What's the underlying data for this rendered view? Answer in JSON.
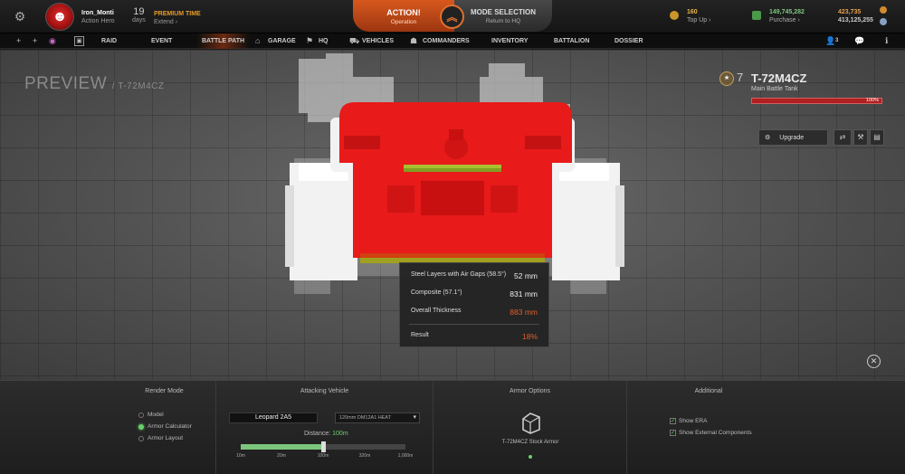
{
  "topbar": {
    "username": "Iron_Monti",
    "rank": "Action Hero",
    "premium_days": "19",
    "premium_days_unit": "days",
    "premium_label": "PREMIUM TIME",
    "premium_action": "Extend ›",
    "action_title": "ACTION!",
    "action_sub": "Operation",
    "mode_title": "MODE SELECTION",
    "mode_sub": "Return to HQ",
    "gold_value": "160",
    "gold_action": "Top Up ›",
    "credits_value": "149,745,282",
    "credits_action": "Purchase ›",
    "xp_value": "423,735",
    "xp2_value": "413,125,255"
  },
  "nav": {
    "items": [
      "RAID",
      "EVENT",
      "BATTLE PATH",
      "GARAGE",
      "HQ",
      "VEHICLES",
      "COMMANDERS",
      "INVENTORY",
      "BATTALION",
      "DOSSIER"
    ],
    "friends_count": "3"
  },
  "preview": {
    "title": "PREVIEW",
    "subtitle": "/ T-72M4CZ"
  },
  "tank": {
    "tier": "7",
    "name": "T-72M4CZ",
    "class": "Main Battle Tank",
    "health": "100%",
    "upgrade_label": "Upgrade"
  },
  "armor": {
    "rows": [
      {
        "label": "Steel Layers with Air Gaps (58.5°)",
        "value": "52 mm"
      },
      {
        "label": "Composite (57.1°)",
        "value": "831 mm"
      },
      {
        "label": "Overall Thickness",
        "value": "883 mm"
      }
    ],
    "result_label": "Result",
    "result_value": "18%"
  },
  "bottom": {
    "render_mode": {
      "title": "Render Mode",
      "options": [
        "Model",
        "Armor Calculator",
        "Armor Layout"
      ],
      "selected": "Armor Calculator"
    },
    "attacking": {
      "title": "Attacking Vehicle",
      "vehicle": "Leopard 2A5",
      "ammo": "120mm DM12A1 HEAT",
      "distance_label": "Distance:",
      "distance_value": "100m",
      "distance_fraction": 0.5,
      "ticks": [
        "10m",
        "20m",
        "100m",
        "320m",
        "1,000m"
      ]
    },
    "armor_options": {
      "title": "Armor Options",
      "caption": "T-72M4CZ Stock Armor"
    },
    "additional": {
      "title": "Additional",
      "options": [
        "Show ERA",
        "Show External Components"
      ]
    }
  },
  "colors": {
    "accent_orange": "#d7581e",
    "green": "#6bd16b",
    "armor_red": "#e81a1a"
  }
}
